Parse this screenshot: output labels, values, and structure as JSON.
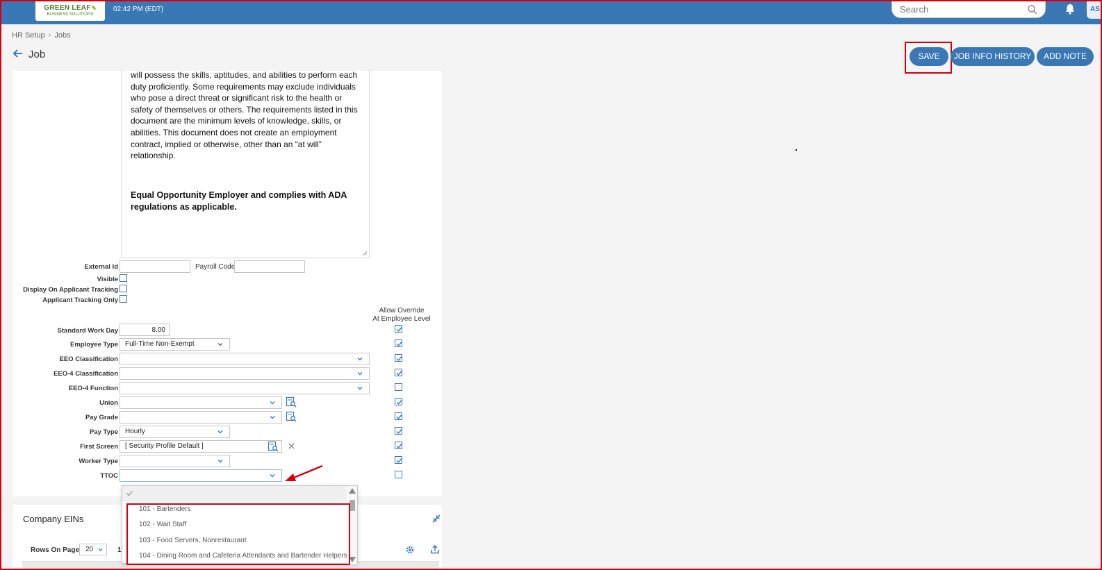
{
  "header": {
    "logo_line1": "GREEN LEAF",
    "logo_line2": "BUSINESS SOLUTIONS",
    "time": "02:42 PM (EDT)",
    "search_placeholder": "Search",
    "avatar_initials": "AS"
  },
  "breadcrumb": {
    "item1": "HR Setup",
    "separator": "›",
    "item2": "Jobs"
  },
  "page": {
    "title": "Job"
  },
  "toolbar": {
    "save": "SAVE",
    "history": "JOB INFO HISTORY",
    "note": "ADD NOTE"
  },
  "description": {
    "lines": [
      "will possess the skills, aptitudes, and abilities to perform each",
      "duty proficiently. Some requirements may exclude individuals",
      "who pose a direct threat or significant risk to the health or",
      "safety of themselves or others. The requirements listed in this",
      "document are the minimum levels of knowledge, skills, or",
      "abilities. This document does not create an employment",
      "contract, implied or otherwise, other than an “at will”",
      "relationship."
    ],
    "bold_line1": "Equal Opportunity Employer and complies with ADA",
    "bold_line2": "regulations as applicable."
  },
  "form": {
    "external_id_label": "External Id",
    "external_id_value": "",
    "payroll_code_label": "Payroll Code",
    "payroll_code_value": "",
    "visible_label": "Visible",
    "display_on_applicant_label": "Display On Applicant Tracking",
    "applicant_only_label": "Applicant Tracking Only",
    "override_header_line1": "Allow Override",
    "override_header_line2": "At Employee Level",
    "standard_work_day_label": "Standard Work Day",
    "standard_work_day_value": "8.00",
    "employee_type_label": "Employee Type",
    "employee_type_value": "Full-Time Non-Exempt",
    "eeo_class_label": "EEO Classification",
    "eeo_class_value": "",
    "eeo4_class_label": "EEO-4 Classification",
    "eeo4_class_value": "",
    "eeo4_function_label": "EEO-4 Function",
    "eeo4_function_value": "",
    "union_label": "Union",
    "union_value": "",
    "pay_grade_label": "Pay Grade",
    "pay_grade_value": "",
    "pay_type_label": "Pay Type",
    "pay_type_value": "Hourly",
    "first_screen_label": "First Screen",
    "first_screen_value": "[ Security Profile Default ]",
    "worker_type_label": "Worker Type",
    "worker_type_value": "",
    "ttoc_label": "TTOC",
    "ttoc_value": ""
  },
  "ttoc_dropdown": {
    "options": [
      "101 - Bartenders",
      "102 - Wait Staff",
      "103 - Food Servers, Nonrestaurant",
      "104 - Dining Room and Cafeteria Attendants and Bartender Helpers"
    ]
  },
  "eins": {
    "title": "Company EINs",
    "rows_label": "Rows On Page",
    "rows_value": "20",
    "page_number": "1"
  },
  "colors": {
    "brand": "#3a78b5",
    "highlight": "#d4000e"
  }
}
